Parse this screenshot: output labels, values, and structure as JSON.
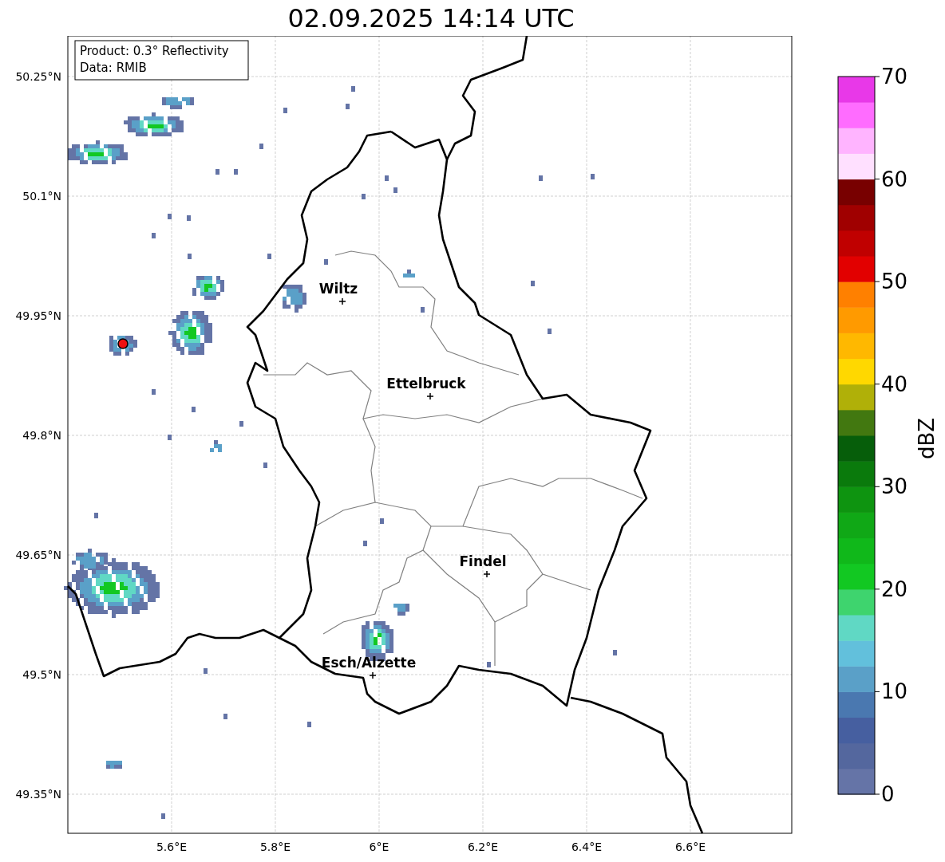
{
  "title": "02.09.2025 14:14 UTC",
  "info_box": {
    "lines": [
      "Product: 0.3° Reflectivity",
      "Data: RMIB"
    ]
  },
  "map": {
    "lat_ticks": [
      "50.25°N",
      "50.1°N",
      "49.95°N",
      "49.8°N",
      "49.65°N",
      "49.5°N",
      "49.35°N"
    ],
    "lon_ticks": [
      "5.6°E",
      "5.8°E",
      "6°E",
      "6.2°E",
      "6.4°E",
      "6.6°E"
    ],
    "cities": [
      {
        "name": "Wiltz"
      },
      {
        "name": "Ettelbruck"
      },
      {
        "name": "Findel"
      },
      {
        "name": "Esch/Alzette"
      }
    ]
  },
  "colorbar": {
    "label": "dBZ",
    "ticks": [
      "70",
      "60",
      "50",
      "40",
      "30",
      "20",
      "10",
      "0"
    ],
    "segments": [
      {
        "color": "#6574a7"
      },
      {
        "color": "#54679e"
      },
      {
        "color": "#465fa0"
      },
      {
        "color": "#4a78b0"
      },
      {
        "color": "#5aa0c8"
      },
      {
        "color": "#62c0dc"
      },
      {
        "color": "#60d8c4"
      },
      {
        "color": "#3ed46e"
      },
      {
        "color": "#12c822"
      },
      {
        "color": "#10b81a"
      },
      {
        "color": "#10a816"
      },
      {
        "color": "#0e9410"
      },
      {
        "color": "#0a7a0c"
      },
      {
        "color": "#065e0a"
      },
      {
        "color": "#427810"
      },
      {
        "color": "#b0b008"
      },
      {
        "color": "#ffd800"
      },
      {
        "color": "#ffb800"
      },
      {
        "color": "#ff9a00"
      },
      {
        "color": "#ff8000"
      },
      {
        "color": "#e20000"
      },
      {
        "color": "#c00000"
      },
      {
        "color": "#a00000"
      },
      {
        "color": "#780000"
      },
      {
        "color": "#ffe0ff"
      },
      {
        "color": "#ffb4ff"
      },
      {
        "color": "#ff6cff"
      },
      {
        "color": "#e838e8"
      }
    ]
  }
}
